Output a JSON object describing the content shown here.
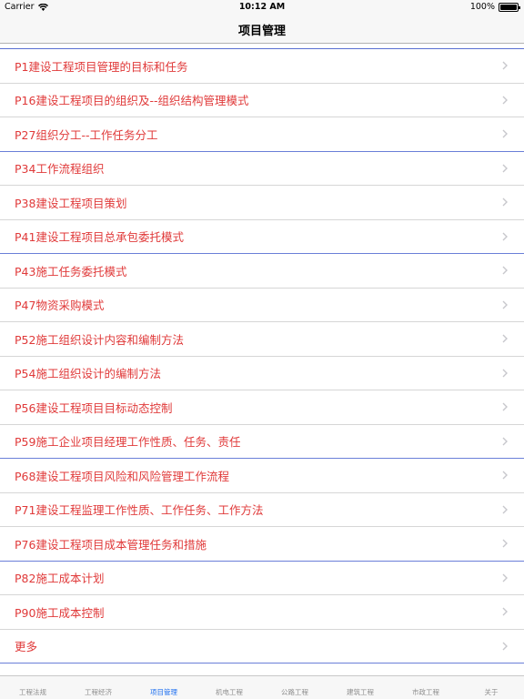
{
  "status_bar": {
    "carrier": "Carrier",
    "wifi_icon": "wifi-icon",
    "time": "10:12 AM",
    "battery_percent": "100%",
    "battery_level": 1.0
  },
  "nav": {
    "title": "项目管理"
  },
  "list": {
    "chevron_icon": "chevron-right-icon",
    "label_color": "#e03a3a",
    "items": [
      {
        "label": "P1建设工程项目管理的目标和任务"
      },
      {
        "label": "P16建设工程项目的组织及--组织结构管理模式"
      },
      {
        "label": "P27组织分工--工作任务分工"
      },
      {
        "label": "P34工作流程组织"
      },
      {
        "label": "P38建设工程项目策划"
      },
      {
        "label": "P41建设工程项目总承包委托模式"
      },
      {
        "label": "P43施工任务委托模式"
      },
      {
        "label": "P47物资采购模式"
      },
      {
        "label": "P52施工组织设计内容和编制方法"
      },
      {
        "label": "P54施工组织设计的编制方法"
      },
      {
        "label": "P56建设工程项目目标动态控制"
      },
      {
        "label": "P59施工企业项目经理工作性质、任务、责任"
      },
      {
        "label": "P68建设工程项目风险和风险管理工作流程"
      },
      {
        "label": "P71建设工程监理工作性质、工作任务、工作方法"
      },
      {
        "label": "P76建设工程项目成本管理任务和措施"
      },
      {
        "label": "P82施工成本计划"
      },
      {
        "label": "P90施工成本控制"
      },
      {
        "label": "更多"
      }
    ]
  },
  "tab_bar": {
    "active_color": "#1d6ff0",
    "tabs": [
      {
        "label": "工程法规"
      },
      {
        "label": "工程经济"
      },
      {
        "label": "项目管理",
        "active": true
      },
      {
        "label": "机电工程"
      },
      {
        "label": "公路工程"
      },
      {
        "label": "建筑工程"
      },
      {
        "label": "市政工程"
      },
      {
        "label": "关于"
      }
    ]
  }
}
